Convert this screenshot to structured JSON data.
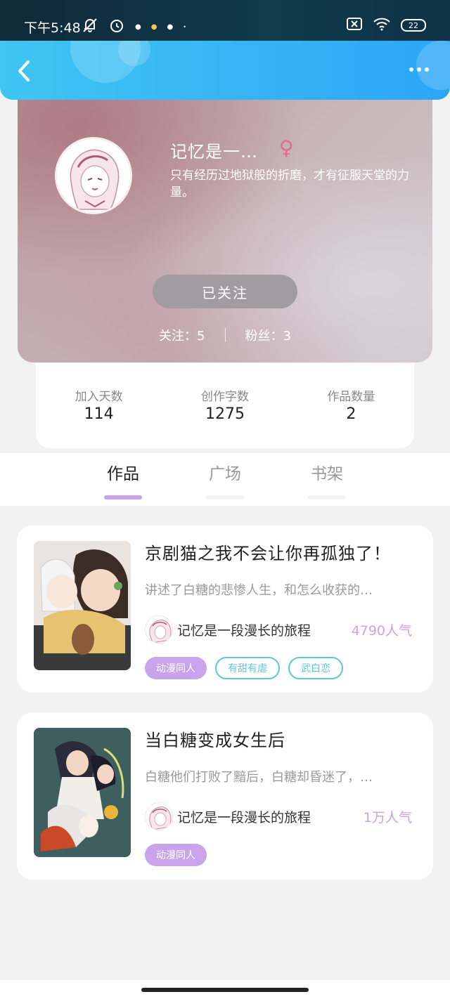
{
  "status_bar": {
    "time": "下午5:48",
    "battery": "22"
  },
  "profile": {
    "username": "记忆是一…",
    "gender_symbol": "♀",
    "bio": "只有经历过地狱般的折磨，才有征服天堂的力量。",
    "follow_button": "已关注",
    "following_label": "关注：5",
    "fans_label": "粉丝：3"
  },
  "stats": [
    {
      "label": "加入天数",
      "value": "114"
    },
    {
      "label": "创作字数",
      "value": "1275"
    },
    {
      "label": "作品数量",
      "value": "2"
    }
  ],
  "tabs": [
    {
      "label": "作品"
    },
    {
      "label": "广场"
    },
    {
      "label": "书架"
    }
  ],
  "works": [
    {
      "title": "京剧猫之我不会让你再孤独了！",
      "description": "讲述了白糖的悲惨人生，和怎么收获的…",
      "author": "记忆是一段漫长的旅程",
      "popularity": "4790人气",
      "tags": [
        "动漫同人",
        "有甜有虐",
        "武白恋"
      ]
    },
    {
      "title": "当白糖变成女生后",
      "description": "白糖他们打败了黯后，白糖却昏迷了，…",
      "author": "记忆是一段漫长的旅程",
      "popularity": "1万人气",
      "tags": [
        "动漫同人"
      ]
    }
  ],
  "colors": {
    "header_blue": "#35b3f5",
    "accent_purple": "#c9a3ec",
    "tag_teal": "#5cc8d6",
    "gender_pink": "#e46a8f"
  }
}
